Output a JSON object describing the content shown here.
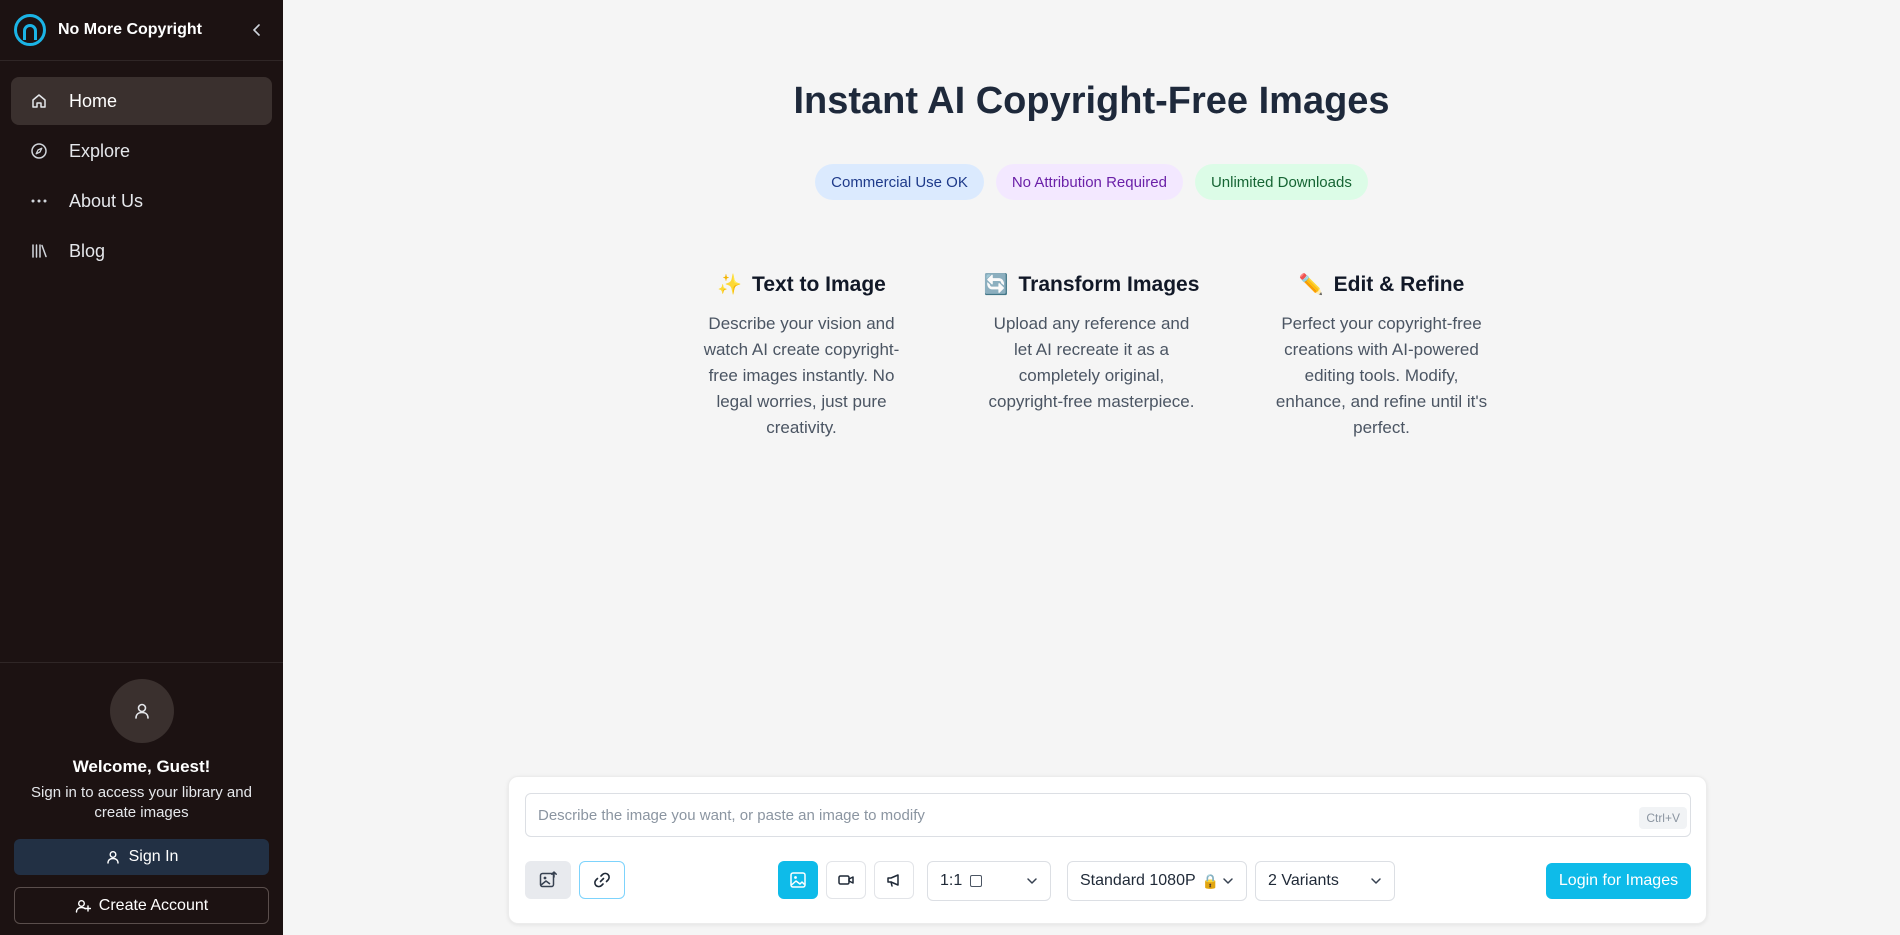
{
  "sidebar": {
    "brand": "No More Copyright",
    "items": [
      {
        "label": "Home",
        "icon": "home-icon"
      },
      {
        "label": "Explore",
        "icon": "compass-icon"
      },
      {
        "label": "About Us",
        "icon": "dots-icon"
      },
      {
        "label": "Blog",
        "icon": "library-icon"
      }
    ],
    "welcome_title": "Welcome, Guest!",
    "welcome_sub": "Sign in to access your library and create images",
    "sign_in_label": "Sign In",
    "create_account_label": "Create Account"
  },
  "hero": {
    "title": "Instant AI Copyright-Free Images",
    "badges": [
      "Commercial Use OK",
      "No Attribution Required",
      "Unlimited Downloads"
    ]
  },
  "features": [
    {
      "emoji": "✨",
      "title": "Text to Image",
      "desc": "Describe your vision and watch AI create copyright-free images instantly. No legal worries, just pure creativity."
    },
    {
      "emoji": "🔄",
      "title": "Transform Images",
      "desc": "Upload any reference and let AI recreate it as a completely original, copyright-free masterpiece."
    },
    {
      "emoji": "✏️",
      "title": "Edit & Refine",
      "desc": "Perfect your copyright-free creations with AI-powered editing tools. Modify, enhance, and refine until it's perfect."
    }
  ],
  "prompt": {
    "placeholder": "Describe the image you want, or paste an image to modify",
    "value": "",
    "paste_hint": "Ctrl+V",
    "aspect_ratio": "1:1",
    "quality": "Standard 1080P",
    "quality_lock": "🔒",
    "variants": "2 Variants",
    "login_label": "Login for Images"
  },
  "colors": {
    "accent": "#0ebbe9",
    "sidebar_bg": "#1c1212",
    "signin_bg": "#223044"
  }
}
